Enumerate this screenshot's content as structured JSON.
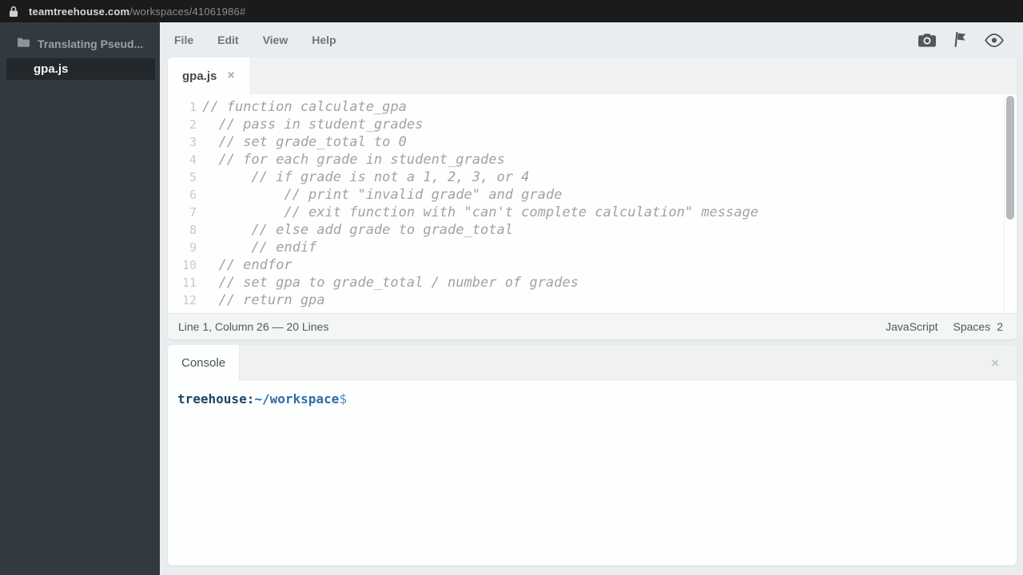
{
  "browser": {
    "url_host": "teamtreehouse.com",
    "url_path": "/workspaces/41061986#"
  },
  "sidebar": {
    "project_label": "Translating Pseud...",
    "file": {
      "name": "gpa.js"
    }
  },
  "menubar": {
    "items": [
      "File",
      "Edit",
      "View",
      "Help"
    ]
  },
  "editor": {
    "tab": {
      "label": "gpa.js",
      "close": "×"
    },
    "lines": [
      {
        "n": "1",
        "text": "// function calculate_gpa"
      },
      {
        "n": "2",
        "text": "  // pass in student_grades"
      },
      {
        "n": "3",
        "text": "  // set grade_total to 0"
      },
      {
        "n": "4",
        "text": "  // for each grade in student_grades"
      },
      {
        "n": "5",
        "text": "      // if grade is not a 1, 2, 3, or 4"
      },
      {
        "n": "6",
        "text": "          // print \"invalid grade\" and grade"
      },
      {
        "n": "7",
        "text": "          // exit function with \"can't complete calculation\" message"
      },
      {
        "n": "8",
        "text": "      // else add grade to grade_total"
      },
      {
        "n": "9",
        "text": "      // endif"
      },
      {
        "n": "10",
        "text": "  // endfor"
      },
      {
        "n": "11",
        "text": "  // set gpa to grade_total / number of grades"
      },
      {
        "n": "12",
        "text": "  // return gpa"
      }
    ],
    "status": {
      "position": "Line 1, Column 26 — 20 Lines",
      "language": "JavaScript",
      "indent_type": "Spaces",
      "indent_size": "2"
    }
  },
  "console": {
    "tab_label": "Console",
    "close": "×",
    "prompt": {
      "user": "treehouse",
      "colon": ":",
      "path": "~/workspace",
      "dollar": "$"
    }
  },
  "colors": {
    "topbar_bg": "#1b1b1b",
    "sidebar_bg": "#323a41",
    "selected_file_bg": "#23282d",
    "page_bg": "#e9edef",
    "comment_text": "#9da3a8",
    "prompt_user": "#1c4668",
    "prompt_path": "#2d6ea8"
  }
}
